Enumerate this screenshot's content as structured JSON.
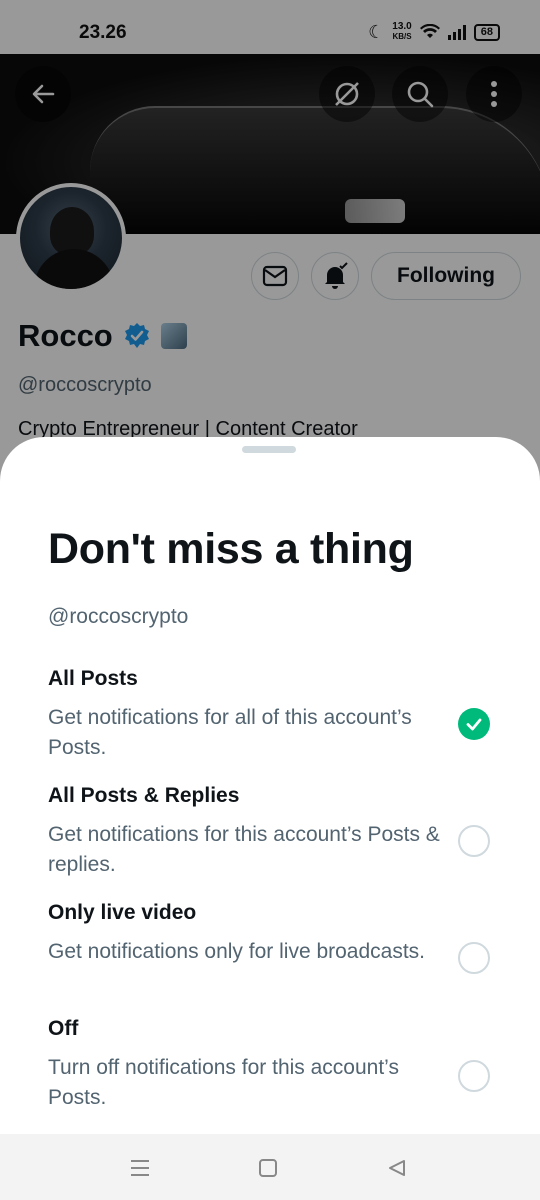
{
  "status_bar": {
    "time": "23.26",
    "net_speed_value": "13.0",
    "net_speed_unit": "KB/S",
    "battery": "68"
  },
  "profile": {
    "name": "Rocco",
    "handle": "@roccoscrypto",
    "bio": "Crypto Entrepreneur | Content Creator",
    "following_label": "Following",
    "verified": true
  },
  "sheet": {
    "title": "Don't miss a thing",
    "handle": "@roccoscrypto",
    "options": [
      {
        "title": "All Posts",
        "description": "Get notifications for all of this account’s Posts.",
        "selected": true
      },
      {
        "title": "All Posts & Replies",
        "description": "Get notifications for this account’s Posts & replies.",
        "selected": false
      },
      {
        "title": "Only live video",
        "description": "Get notifications only for live broadcasts.",
        "selected": false
      },
      {
        "title": "Off",
        "description": "Turn off notifications for this account’s Posts.",
        "selected": false
      }
    ]
  },
  "colors": {
    "accent_green": "#00ba7c",
    "verified_blue": "#1d9bf0",
    "text_primary": "#0f1419",
    "text_secondary": "#536471"
  },
  "icons": {
    "back": "arrow-left-icon",
    "grok": "slashed-circle-icon",
    "search": "search-icon",
    "more": "more-vertical-icon",
    "message": "envelope-icon",
    "notifications": "bell-check-icon",
    "nav_menu": "menu-icon",
    "nav_home": "square-home-icon",
    "nav_back": "triangle-back-icon"
  }
}
